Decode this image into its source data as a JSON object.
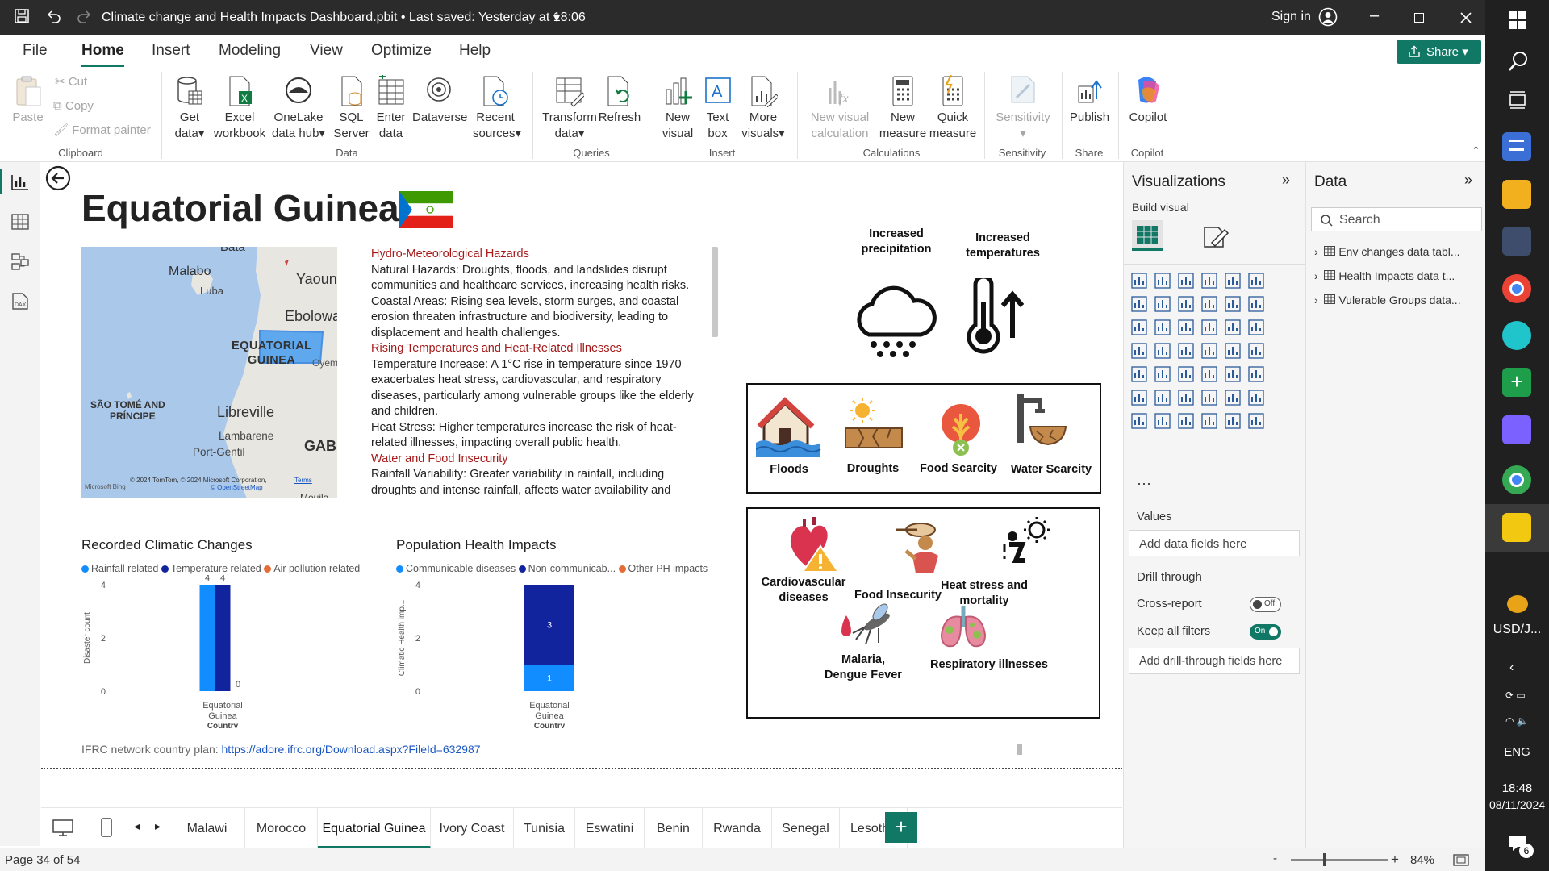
{
  "titlebar": {
    "title": "Climate change and Health Impacts Dashboard.pbit • Last saved: Yesterday at 18:06",
    "signin": "Sign in"
  },
  "menu": [
    "File",
    "Home",
    "Insert",
    "Modeling",
    "View",
    "Optimize",
    "Help"
  ],
  "share": "Share",
  "ribbon": {
    "clipboard": {
      "paste": "Paste",
      "cut": "Cut",
      "copy": "Copy",
      "format_painter": "Format painter",
      "group": "Clipboard"
    },
    "data": {
      "get_data": [
        "Get",
        "data"
      ],
      "excel": [
        "Excel",
        "workbook"
      ],
      "onelake": [
        "OneLake",
        "data hub"
      ],
      "sql": [
        "SQL",
        "Server"
      ],
      "enter": [
        "Enter",
        "data"
      ],
      "dataverse": "Dataverse",
      "recent": [
        "Recent",
        "sources"
      ],
      "group": "Data"
    },
    "queries": {
      "transform": [
        "Transform",
        "data"
      ],
      "refresh": "Refresh",
      "group": "Queries"
    },
    "insert": {
      "new_visual": [
        "New",
        "visual"
      ],
      "text_box": [
        "Text",
        "box"
      ],
      "more_visuals": [
        "More",
        "visuals"
      ],
      "group": "Insert"
    },
    "calculations": {
      "new_visual_calc": [
        "New visual",
        "calculation"
      ],
      "new_measure": [
        "New",
        "measure"
      ],
      "quick_measure": [
        "Quick",
        "measure"
      ],
      "group": "Calculations"
    },
    "sensitivity": {
      "label": "Sensitivity",
      "group": "Sensitivity"
    },
    "share": {
      "publish": "Publish",
      "group": "Share"
    },
    "copilot": {
      "label": "Copilot",
      "group": "Copilot"
    }
  },
  "report": {
    "country": "Equatorial Guinea",
    "map_labels": {
      "malabo": "Malabo",
      "luba": "Luba",
      "yaounde": "Yaoun",
      "ebolowa": "Ebolowa",
      "eq": "EQUATORIAL",
      "guinea": "GUINEA",
      "oyem": "Oyem",
      "sao_tome": "SÃO TOMÉ AND",
      "principe": "PRÍNCIPE",
      "libreville": "Libreville",
      "lambarene": "Lambarene",
      "port_gentil": "Port-Gentil",
      "gab": "GAB",
      "bata": "Bata",
      "mouila": "Mouila"
    },
    "map_attribution": {
      "bing": "Microsoft Bing",
      "copyright": "© 2024 TomTom, © 2024 Microsoft Corporation,",
      "terms": "Terms",
      "osm": "© OpenStreetMap"
    },
    "text": [
      {
        "style": "red",
        "text": "Hydro-Meteorological Hazards"
      },
      {
        "style": "normal",
        "text": "Natural Hazards: Droughts, floods, and landslides disrupt communities and healthcare services, increasing health risks."
      },
      {
        "style": "normal",
        "text": "Coastal Areas: Rising sea levels, storm surges, and coastal erosion threaten infrastructure and biodiversity, leading to displacement and health challenges."
      },
      {
        "style": "red",
        "text": "Rising Temperatures and Heat-Related Illnesses"
      },
      {
        "style": "normal",
        "text": "Temperature Increase: A 1°C rise in temperature since 1970 exacerbates heat stress, cardiovascular, and respiratory diseases, particularly among vulnerable groups like the elderly and children."
      },
      {
        "style": "normal",
        "text": "Heat Stress: Higher temperatures increase the risk of heat-related illnesses, impacting overall public health."
      },
      {
        "style": "red",
        "text": "Water and Food Insecurity"
      },
      {
        "style": "normal",
        "text": "Rainfall Variability: Greater variability in rainfall, including droughts and intense rainfall, affects water availability and"
      }
    ],
    "climate_icons": [
      {
        "label": "Increased precipitation",
        "icon": "rain-cloud-icon"
      },
      {
        "label": "Increased temperatures",
        "icon": "thermometer-up-icon"
      }
    ],
    "hazards": [
      {
        "label": "Floods",
        "icon": "flood-icon"
      },
      {
        "label": "Droughts",
        "icon": "drought-icon"
      },
      {
        "label": "Food Scarcity",
        "icon": "food-scarcity-icon"
      },
      {
        "label": "Water Scarcity",
        "icon": "water-scarcity-icon"
      }
    ],
    "health": [
      {
        "label": "Cardiovascular diseases",
        "icon": "heart-warning-icon"
      },
      {
        "label": "Food Insecurity",
        "icon": "food-insecurity-icon"
      },
      {
        "label": "Heat stress and mortality",
        "icon": "heat-stress-icon"
      },
      {
        "label": "Malaria, Dengue Fever",
        "icon": "mosquito-icon"
      },
      {
        "label": "Respiratory illnesses",
        "icon": "lungs-icon"
      }
    ],
    "footer": {
      "label": "IFRC network country plan:",
      "link": "https://adore.ifrc.org/Download.aspx?FileId=632987"
    }
  },
  "chart_data": [
    {
      "type": "bar",
      "title": "Recorded Climatic Changes",
      "categories": [
        "Equatorial Guinea"
      ],
      "series": [
        {
          "name": "Rainfall related",
          "values": [
            4
          ],
          "color": "#118dff"
        },
        {
          "name": "Temperature related",
          "values": [
            4
          ],
          "color": "#12239e"
        },
        {
          "name": "Air pollution related",
          "values": [
            0
          ],
          "color": "#e66c37"
        }
      ],
      "xlabel": "Country",
      "ylabel": "Disaster count",
      "ylim": [
        0,
        4
      ],
      "yticks": [
        0,
        2,
        4
      ]
    },
    {
      "type": "bar",
      "title": "Population Health Impacts",
      "stacked": true,
      "categories": [
        "Equatorial Guinea"
      ],
      "series": [
        {
          "name": "Communicable diseases",
          "values": [
            1
          ],
          "color": "#118dff"
        },
        {
          "name": "Non-communicab...",
          "values": [
            3
          ],
          "color": "#12239e"
        },
        {
          "name": "Other PH impacts",
          "values": [
            0
          ],
          "color": "#e66c37"
        }
      ],
      "xlabel": "Country",
      "ylabel": "Climatic Health imp...",
      "ylim": [
        0,
        4
      ],
      "yticks": [
        0,
        2,
        4
      ]
    }
  ],
  "category_label_lines": [
    "Equatorial",
    "Guinea"
  ],
  "pages": [
    "Malawi",
    "Morocco",
    "Equatorial Guinea",
    "Ivory Coast",
    "Tunisia",
    "Eswatini",
    "Benin",
    "Rwanda",
    "Senegal",
    "Lesotho"
  ],
  "active_page": "Equatorial Guinea",
  "status": {
    "page": "Page 34 of 54",
    "zoom": "84%"
  },
  "viz_pane": {
    "title": "Visualizations",
    "build": "Build visual",
    "values": "Values",
    "add_fields": "Add data fields here",
    "drill": "Drill through",
    "cross": "Cross-report",
    "cross_state": "Off",
    "keep": "Keep all filters",
    "keep_state": "On",
    "drill_fields": "Add drill-through fields here",
    "more": "···"
  },
  "data_pane": {
    "title": "Data",
    "search": "Search",
    "tables": [
      "Env changes data tabl...",
      "Health Impacts data t...",
      "Vulerable Groups data..."
    ]
  },
  "taskbar": {
    "currency": "USD/J...",
    "lang": "ENG",
    "time": "18:48",
    "date": "08/11/2024",
    "notif": "6"
  }
}
